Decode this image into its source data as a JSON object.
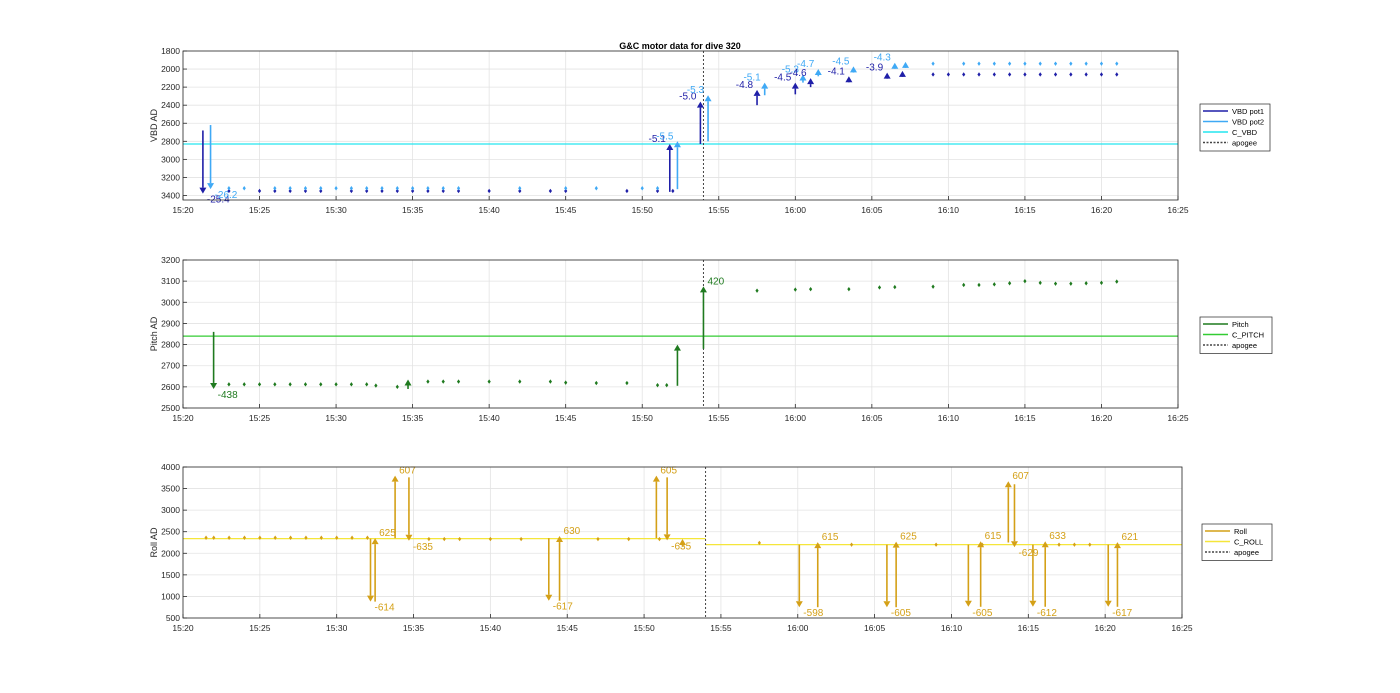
{
  "title": "G&C motor data for dive 320",
  "chart_data": [
    {
      "type": "scatter",
      "ylabel": "VBD AD",
      "ylim": [
        1800,
        3450
      ],
      "y_reversed": true,
      "yticks": [
        1800,
        2000,
        2200,
        2400,
        2600,
        2800,
        3000,
        3200,
        3400
      ],
      "xlim": [
        "15:20",
        "16:25"
      ],
      "xticks": [
        "15:20",
        "15:25",
        "15:30",
        "15:35",
        "15:40",
        "15:45",
        "15:50",
        "15:55",
        "16:00",
        "16:05",
        "16:10",
        "16:15",
        "16:20",
        "16:25"
      ],
      "grid": true,
      "legend": {
        "position": "right",
        "entries": [
          {
            "label": "VBD pot1",
            "color": "#1f1fa8",
            "style": "solid"
          },
          {
            "label": "VBD pot2",
            "color": "#3fa9f5",
            "style": "solid"
          },
          {
            "label": "C_VBD",
            "color": "#24e5ef",
            "style": "solid"
          },
          {
            "label": "apogee",
            "color": "#444444",
            "style": "dotted"
          }
        ]
      },
      "hlines": [
        {
          "name": "C_VBD",
          "y": 2830,
          "color": "#24e5ef"
        }
      ],
      "vlines": [
        {
          "name": "apogee",
          "x": "15:54",
          "color": "#444444"
        }
      ],
      "series": [
        {
          "name": "VBD pot1",
          "color": "#1f1fa8",
          "marker": "diamond",
          "x": [
            "15:23",
            "15:25",
            "15:26",
            "15:27",
            "15:28",
            "15:29",
            "15:31",
            "15:32",
            "15:33",
            "15:34",
            "15:35",
            "15:36",
            "15:37",
            "15:38",
            "15:40",
            "15:42",
            "15:44",
            "15:45",
            "15:49",
            "15:51",
            "15:52",
            "16:09",
            "16:10",
            "16:11",
            "16:12",
            "16:13",
            "16:14",
            "16:15",
            "16:16",
            "16:17",
            "16:18",
            "16:19",
            "16:20",
            "16:21"
          ],
          "y": [
            3350,
            3350,
            3350,
            3350,
            3350,
            3350,
            3350,
            3350,
            3350,
            3350,
            3350,
            3350,
            3350,
            3350,
            3350,
            3350,
            3350,
            3350,
            3350,
            3350,
            3350,
            2060,
            2060,
            2060,
            2060,
            2060,
            2060,
            2060,
            2060,
            2060,
            2060,
            2060,
            2060,
            2060
          ]
        },
        {
          "name": "VBD pot2",
          "color": "#3fa9f5",
          "marker": "diamond",
          "x": [
            "15:23",
            "15:24",
            "15:26",
            "15:27",
            "15:28",
            "15:29",
            "15:30",
            "15:31",
            "15:32",
            "15:33",
            "15:34",
            "15:35",
            "15:36",
            "15:37",
            "15:38",
            "15:42",
            "15:45",
            "15:47",
            "15:50",
            "15:51",
            "16:09",
            "16:11",
            "16:12",
            "16:13",
            "16:14",
            "16:15",
            "16:16",
            "16:17",
            "16:18",
            "16:19",
            "16:20",
            "16:21"
          ],
          "y": [
            3320,
            3320,
            3320,
            3320,
            3320,
            3320,
            3320,
            3320,
            3320,
            3320,
            3320,
            3320,
            3320,
            3320,
            3320,
            3320,
            3320,
            3320,
            3320,
            3320,
            1940,
            1940,
            1940,
            1940,
            1940,
            1940,
            1940,
            1940,
            1940,
            1940,
            1940,
            1940
          ]
        }
      ],
      "moves": [
        {
          "x": "15:21.3",
          "from": 2680,
          "to": 3380,
          "label": "-25.4",
          "color": "#1f1fa8"
        },
        {
          "x": "15:21.8",
          "from": 2620,
          "to": 3330,
          "label": "-26.2",
          "color": "#3fa9f5"
        },
        {
          "x": "15:51.8",
          "from": 3360,
          "to": 2830,
          "label": "-5.1",
          "color": "#1f1fa8"
        },
        {
          "x": "15:52.3",
          "from": 3330,
          "to": 2800,
          "label": "-5.5",
          "color": "#3fa9f5"
        },
        {
          "x": "15:53.8",
          "from": 2830,
          "to": 2360,
          "label": "-5.0",
          "color": "#1f1fa8"
        },
        {
          "x": "15:54.3",
          "from": 2800,
          "to": 2290,
          "label": "-5.3",
          "color": "#3fa9f5"
        },
        {
          "x": "15:57.5",
          "from": 2400,
          "to": 2230,
          "label": "-4.8",
          "color": "#1f1fa8"
        },
        {
          "x": "15:58.0",
          "from": 2290,
          "to": 2150,
          "label": "-5.1",
          "color": "#3fa9f5"
        },
        {
          "x": "16:00.0",
          "from": 2280,
          "to": 2150,
          "label": "-4.5",
          "color": "#1f1fa8"
        },
        {
          "x": "16:00.5",
          "from": 2150,
          "to": 2060,
          "label": "-5.3",
          "color": "#3fa9f5"
        },
        {
          "x": "16:01.0",
          "from": 2200,
          "to": 2100,
          "label": "-4.6",
          "color": "#1f1fa8"
        },
        {
          "x": "16:01.5",
          "from": 2080,
          "to": 2000,
          "label": "-4.7",
          "color": "#3fa9f5"
        },
        {
          "x": "16:03.5",
          "from": 2140,
          "to": 2080,
          "label": "-4.1",
          "color": "#1f1fa8"
        },
        {
          "x": "16:03.8",
          "from": 2040,
          "to": 1970,
          "label": "-4.5",
          "color": "#3fa9f5"
        },
        {
          "x": "16:06.0",
          "from": 2080,
          "to": 2040,
          "label": "-3.9",
          "color": "#1f1fa8"
        },
        {
          "x": "16:06.5",
          "from": 1970,
          "to": 1930,
          "label": "-4.3",
          "color": "#3fa9f5"
        },
        {
          "x": "16:07.0",
          "from": 2060,
          "to": 2020,
          "label": "",
          "color": "#1f1fa8"
        },
        {
          "x": "16:07.2",
          "from": 1960,
          "to": 1920,
          "label": "",
          "color": "#3fa9f5"
        }
      ]
    },
    {
      "type": "scatter",
      "ylabel": "Pitch AD",
      "ylim": [
        2500,
        3200
      ],
      "yticks": [
        2500,
        2600,
        2700,
        2800,
        2900,
        3000,
        3100,
        3200
      ],
      "xlim": [
        "15:20",
        "16:25"
      ],
      "xticks": [
        "15:20",
        "15:25",
        "15:30",
        "15:35",
        "15:40",
        "15:45",
        "15:50",
        "15:55",
        "16:00",
        "16:05",
        "16:10",
        "16:15",
        "16:20",
        "16:25"
      ],
      "grid": true,
      "legend": {
        "position": "right",
        "entries": [
          {
            "label": "Pitch",
            "color": "#1f7a1f",
            "style": "solid"
          },
          {
            "label": "C_PITCH",
            "color": "#33cc33",
            "style": "solid"
          },
          {
            "label": "apogee",
            "color": "#444444",
            "style": "dotted"
          }
        ]
      },
      "hlines": [
        {
          "name": "C_PITCH",
          "y": 2840,
          "color": "#33cc33"
        }
      ],
      "vlines": [
        {
          "name": "apogee",
          "x": "15:54",
          "color": "#444444"
        }
      ],
      "series": [
        {
          "name": "Pitch",
          "color": "#1f7a1f",
          "marker": "diamond",
          "x": [
            "15:23",
            "15:24",
            "15:25",
            "15:26",
            "15:27",
            "15:28",
            "15:29",
            "15:30",
            "15:31",
            "15:32",
            "15:32.6",
            "15:34",
            "15:36",
            "15:37",
            "15:38",
            "15:40",
            "15:42",
            "15:44",
            "15:45",
            "15:47",
            "15:49",
            "15:51",
            "15:51.6",
            "15:57.5",
            "16:00",
            "16:01",
            "16:03.5",
            "16:05.5",
            "16:06.5",
            "16:09",
            "16:11",
            "16:12",
            "16:13",
            "16:14",
            "16:15",
            "16:16",
            "16:17",
            "16:18",
            "16:19",
            "16:20",
            "16:21"
          ],
          "y": [
            2612,
            2612,
            2612,
            2612,
            2612,
            2612,
            2612,
            2612,
            2612,
            2612,
            2606,
            2600,
            2625,
            2625,
            2625,
            2625,
            2625,
            2625,
            2620,
            2618,
            2618,
            2608,
            2608,
            3055,
            3060,
            3062,
            3062,
            3070,
            3072,
            3074,
            3082,
            3082,
            3085,
            3090,
            3100,
            3092,
            3088,
            3088,
            3090,
            3092,
            3098
          ]
        }
      ],
      "moves": [
        {
          "x": "15:22",
          "from": 2860,
          "to": 2590,
          "label": "-438",
          "color": "#1f7a1f"
        },
        {
          "x": "15:34.7",
          "from": 2590,
          "to": 2635,
          "label": "",
          "color": "#1f7a1f"
        },
        {
          "x": "15:52.3",
          "from": 2605,
          "to": 2800,
          "label": "",
          "color": "#1f7a1f"
        },
        {
          "x": "15:54",
          "from": 2780,
          "to": 3075,
          "label": "420",
          "color": "#1f7a1f"
        }
      ]
    },
    {
      "type": "scatter",
      "ylabel": "Roll AD",
      "ylim": [
        500,
        4000
      ],
      "yticks": [
        500,
        1000,
        1500,
        2000,
        2500,
        3000,
        3500,
        4000
      ],
      "xlim": [
        "15:20",
        "16:25"
      ],
      "xticks": [
        "15:20",
        "15:25",
        "15:30",
        "15:35",
        "15:40",
        "15:45",
        "15:50",
        "15:55",
        "16:00",
        "16:05",
        "16:10",
        "16:15",
        "16:20",
        "16:25"
      ],
      "grid": true,
      "legend": {
        "position": "right",
        "entries": [
          {
            "label": "Roll",
            "color": "#d4a017",
            "style": "solid"
          },
          {
            "label": "C_ROLL",
            "color": "#f5e63a",
            "style": "solid"
          },
          {
            "label": "apogee",
            "color": "#444444",
            "style": "dotted"
          }
        ]
      },
      "hlines": [
        {
          "name": "C_ROLL",
          "y": 2340,
          "color": "#f5e63a",
          "x_from": "15:20",
          "x_to": "15:54"
        },
        {
          "name": "C_ROLL",
          "y": 2200,
          "color": "#f5e63a",
          "x_from": "15:54",
          "x_to": "16:25"
        }
      ],
      "vlines": [
        {
          "name": "apogee",
          "x": "15:54",
          "color": "#444444"
        }
      ],
      "series": [
        {
          "name": "Roll",
          "color": "#d4a017",
          "marker": "diamond",
          "x": [
            "15:21.5",
            "15:22",
            "15:23",
            "15:24",
            "15:25",
            "15:26",
            "15:27",
            "15:28",
            "15:29",
            "15:30",
            "15:31",
            "15:32",
            "15:36",
            "15:37",
            "15:38",
            "15:40",
            "15:42",
            "15:47",
            "15:49",
            "15:51",
            "15:57.5",
            "16:03.5",
            "16:09",
            "16:12",
            "16:17",
            "16:18",
            "16:19"
          ],
          "y": [
            2360,
            2360,
            2360,
            2360,
            2360,
            2360,
            2360,
            2360,
            2360,
            2360,
            2360,
            2360,
            2330,
            2330,
            2330,
            2330,
            2330,
            2330,
            2330,
            2330,
            2240,
            2200,
            2200,
            2200,
            2200,
            2200,
            2200
          ]
        }
      ],
      "moves": [
        {
          "x": "15:32.2",
          "from": 2340,
          "to": 880,
          "label": "-614",
          "color": "#d4a017"
        },
        {
          "x": "15:32.5",
          "from": 880,
          "to": 2350,
          "label": "625",
          "color": "#d4a017"
        },
        {
          "x": "15:33.8",
          "from": 2350,
          "to": 3800,
          "label": "607",
          "color": "#d4a017"
        },
        {
          "x": "15:34.7",
          "from": 3760,
          "to": 2290,
          "label": "-635",
          "color": "#d4a017"
        },
        {
          "x": "15:43.8",
          "from": 2350,
          "to": 900,
          "label": "-617",
          "color": "#d4a017"
        },
        {
          "x": "15:44.5",
          "from": 900,
          "to": 2400,
          "label": "630",
          "color": "#d4a017"
        },
        {
          "x": "15:50.8",
          "from": 2350,
          "to": 3800,
          "label": "605",
          "color": "#d4a017"
        },
        {
          "x": "15:51.5",
          "from": 3760,
          "to": 2300,
          "label": "-635",
          "color": "#d4a017"
        },
        {
          "x": "15:52.5",
          "from": 2150,
          "to": 2330,
          "label": "",
          "color": "#d4a017"
        },
        {
          "x": "16:00.1",
          "from": 2200,
          "to": 750,
          "label": "-598",
          "color": "#d4a017"
        },
        {
          "x": "16:01.3",
          "from": 750,
          "to": 2260,
          "label": "615",
          "color": "#d4a017"
        },
        {
          "x": "16:05.8",
          "from": 2200,
          "to": 750,
          "label": "-605",
          "color": "#d4a017"
        },
        {
          "x": "16:06.4",
          "from": 750,
          "to": 2270,
          "label": "625",
          "color": "#d4a017"
        },
        {
          "x": "16:11.1",
          "from": 2200,
          "to": 760,
          "label": "-605",
          "color": "#d4a017"
        },
        {
          "x": "16:11.9",
          "from": 760,
          "to": 2280,
          "label": "615",
          "color": "#d4a017"
        },
        {
          "x": "16:13.7",
          "from": 2250,
          "to": 3670,
          "label": "607",
          "color": "#d4a017"
        },
        {
          "x": "16:14.1",
          "from": 3600,
          "to": 2140,
          "label": "-629",
          "color": "#d4a017"
        },
        {
          "x": "16:15.3",
          "from": 2200,
          "to": 760,
          "label": "-612",
          "color": "#d4a017"
        },
        {
          "x": "16:16.1",
          "from": 760,
          "to": 2280,
          "label": "633",
          "color": "#d4a017"
        },
        {
          "x": "16:20.2",
          "from": 2200,
          "to": 760,
          "label": "-617",
          "color": "#d4a017"
        },
        {
          "x": "16:20.8",
          "from": 760,
          "to": 2260,
          "label": "621",
          "color": "#d4a017"
        }
      ]
    }
  ]
}
